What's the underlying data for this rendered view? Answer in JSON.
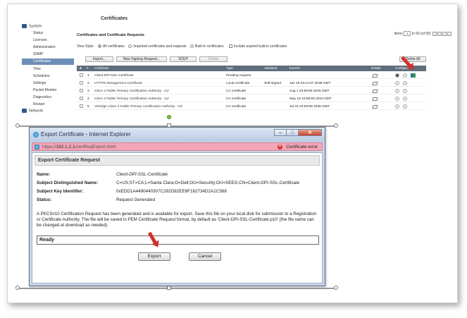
{
  "sidebar": {
    "top_item": "",
    "system_label": "System",
    "items": [
      "Status",
      "Licenses",
      "Administration",
      "SNMP",
      "Certificates",
      "Time",
      "Schedules",
      "Settings",
      "Packet Monitor",
      "Diagnostics",
      "Restart"
    ],
    "selected": "Certificates",
    "network_label": "Network"
  },
  "page": {
    "breadcrumb": "",
    "title": "Certificates",
    "section_title": "Certificates and Certificate Requests",
    "items_label": "Items",
    "items_value": "1",
    "items_range": "to 50 (of 55)",
    "view_style_label": "View Style:",
    "view_options": [
      "All certificates",
      "Imported certificates and requests",
      "Built-in certificates"
    ],
    "include_expired": "Include expired built-in certificates",
    "buttons": {
      "import": "Import...",
      "new_request": "New Signing Request...",
      "scep": "SCEP",
      "delete": "Delete",
      "delete_all": "Delete All"
    },
    "columns": [
      "#",
      "Certificate",
      "Type",
      "Validated",
      "Expires",
      "Details",
      "Configure"
    ],
    "rows": [
      {
        "num": "1",
        "name": "Client-DPI-SSL-Certificate",
        "type": "Pending request",
        "validated": "",
        "expires": ""
      },
      {
        "num": "2",
        "name": "HTTPS Management Certificate",
        "type": "Local certificate",
        "validated": "Self-signed",
        "expires": "Jan 19 03:14:07 2038 GMT"
      },
      {
        "num": "3",
        "name": "Class 3 Public Primary Certification Authority - G2",
        "type": "CA certificate",
        "validated": "",
        "expires": "Aug 1 23:59:59 2028 GMT"
      },
      {
        "num": "4",
        "name": "Class 3 Public Primary Certification Authority - G2",
        "type": "CA certificate",
        "validated": "",
        "expires": "May 18 23:59:59 2018 GMT"
      },
      {
        "num": "5",
        "name": "VeriSign Class 3 Public Primary Certification Authority - G5",
        "type": "CA certificate",
        "validated": "",
        "expires": "Jul 16 23:59:59 2036 GMT"
      }
    ]
  },
  "dialog": {
    "title": "Export Certificate - Internet Explorer",
    "url_prefix": "https://",
    "url_host": "192.1.2.1",
    "url_path": "/certReqExport.html",
    "cert_error": "Certificate error",
    "heading": "Export Certificate Request",
    "fields": [
      {
        "label": "Name:",
        "value": "Client-DPI-SSL-Certificate"
      },
      {
        "label": "Subject Distinguished Name:",
        "value": "C=US;ST=CA;L=Santa Clara;O=Dell;OU=Security;OU=SEEG;CN=Client-DPI-SSL-Certificate"
      },
      {
        "label": "Subject Key Identifier:",
        "value": "0xEDD1A4490440307C292D82EE6F162734D2A1C568"
      },
      {
        "label": "Status:",
        "value": "Request Generated"
      }
    ],
    "message": "A PKCS#10 Certification Request has been generated and is available for export. Save this file on your local disk for submission to a Registration or Certificate Authority. The file will be saved in PEM Certificate Request format, by default as 'Client-DPI-SSL-Certificate.p10' (the file name can be changed at download as needed).",
    "ready": "Ready",
    "export_label": "Export",
    "cancel_label": "Cancel"
  },
  "colors": {
    "accent_arrow": "#d0312d",
    "addr_bar": "#f2a6b7",
    "titlebar": "#c9d6e8",
    "sidebar_selected": "#6d8fb5"
  }
}
